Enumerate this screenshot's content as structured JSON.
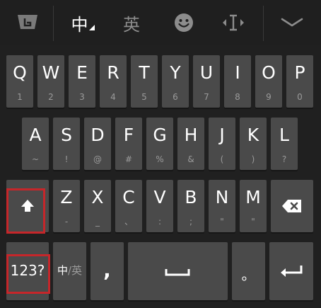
{
  "toolbar": {
    "logo_icon": "keyboard-logo-icon",
    "chinese_label": "中",
    "english_label": "英",
    "emoji_icon": "smiley-icon",
    "cursor_icon": "cursor-move-icon",
    "collapse_icon": "chevron-down-icon"
  },
  "rows": {
    "row1": [
      {
        "main": "Q",
        "sub": "1"
      },
      {
        "main": "W",
        "sub": "2"
      },
      {
        "main": "E",
        "sub": "3"
      },
      {
        "main": "R",
        "sub": "4"
      },
      {
        "main": "T",
        "sub": "5"
      },
      {
        "main": "Y",
        "sub": "6"
      },
      {
        "main": "U",
        "sub": "7"
      },
      {
        "main": "I",
        "sub": "8"
      },
      {
        "main": "O",
        "sub": "9"
      },
      {
        "main": "P",
        "sub": "0"
      }
    ],
    "row2": [
      {
        "main": "A",
        "sub": "~"
      },
      {
        "main": "S",
        "sub": "!"
      },
      {
        "main": "D",
        "sub": "@"
      },
      {
        "main": "F",
        "sub": "#"
      },
      {
        "main": "G",
        "sub": "%"
      },
      {
        "main": "H",
        "sub": "&"
      },
      {
        "main": "J",
        "sub": "("
      },
      {
        "main": "K",
        "sub": ")"
      },
      {
        "main": "L",
        "sub": "?"
      }
    ],
    "row3": [
      {
        "main": "Z",
        "sub": "-"
      },
      {
        "main": "X",
        "sub": "_"
      },
      {
        "main": "C",
        "sub": "、"
      },
      {
        "main": "V",
        "sub": ":"
      },
      {
        "main": "B",
        "sub": ";"
      },
      {
        "main": "N",
        "sub": "\""
      },
      {
        "main": "M",
        "sub": "\""
      }
    ]
  },
  "bottom_row": {
    "numbers_label": "123?",
    "lang_switch_label_cn": "中",
    "lang_switch_label_en": "/英",
    "comma_label": ",",
    "period_label": "。"
  },
  "icons": {
    "shift": "shift-arrow-icon",
    "backspace": "backspace-icon",
    "space": "space-bar-icon",
    "enter": "enter-return-icon"
  },
  "highlight_color": "#c6262a",
  "key_color": "#4a4a4a",
  "background_color": "#1f1f1f"
}
